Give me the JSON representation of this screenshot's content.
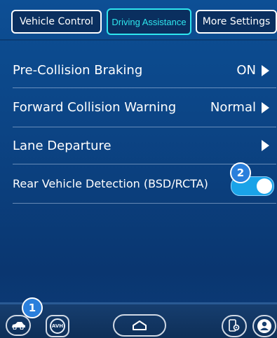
{
  "tabs": [
    {
      "label": "Vehicle Control",
      "active": false
    },
    {
      "label": "Driving Assistance",
      "active": true
    },
    {
      "label": "More Settings",
      "active": false
    }
  ],
  "rows": [
    {
      "label": "Pre-Collision Braking",
      "value": "ON"
    },
    {
      "label": "Forward Collision Warning",
      "value": "Normal"
    },
    {
      "label": "Lane Departure",
      "value": ""
    },
    {
      "label": "Rear Vehicle Detection (BSD/RCTA)",
      "toggle_on": true
    }
  ],
  "badges": {
    "one": "1",
    "two": "2"
  },
  "bottom_bar": {
    "avh_label": "AVH",
    "icons": [
      "car-icon",
      "avh-icon",
      "home-icon",
      "phone-settings-icon",
      "user-icon"
    ]
  },
  "colors": {
    "accent": "#2ee6ee",
    "toggle": "#1aa3e8",
    "badge": "#2a7fdc",
    "background": "#0d4f95"
  }
}
